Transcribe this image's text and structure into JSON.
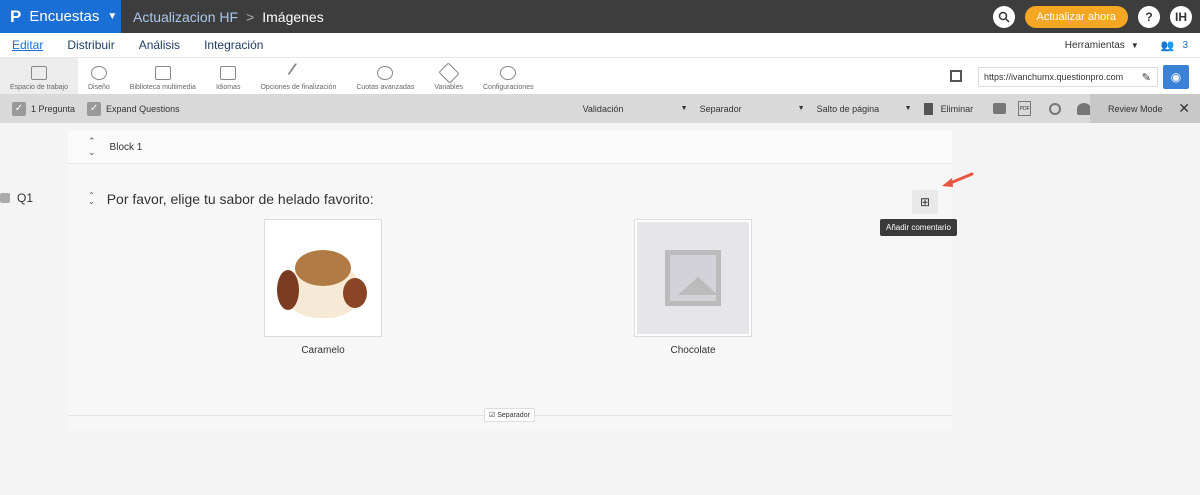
{
  "header": {
    "brand_logo": "P",
    "brand_name": "Encuestas",
    "crumb_survey": "Actualizacion HF",
    "crumb_separator": ">",
    "crumb_page": "Imágenes",
    "update_label": "Actualizar ahora",
    "help_label": "?",
    "user_initials": "IH"
  },
  "menu": {
    "items": [
      "Editar",
      "Distribuir",
      "Análisis",
      "Integración"
    ],
    "tools_label": "Herramientas",
    "collaborators_count": "3"
  },
  "toolbar": {
    "items": [
      "Espacio de trabajo",
      "Diseño",
      "Biblioteca multimedia",
      "Idiomas",
      "Opciones de finalización",
      "Cuotas avanzadas",
      "Variables",
      "Configuraciones"
    ],
    "url": "https://ivanchumx.questionpro.com"
  },
  "graybar": {
    "one_question": "1 Pregunta",
    "expand_questions": "Expand Questions",
    "validation": "Validación",
    "separator": "Separador",
    "page_break": "Salto de página",
    "delete": "Eliminar",
    "review_mode": "Review Mode"
  },
  "block": {
    "title": "Block 1"
  },
  "question": {
    "number": "Q1",
    "text": "Por favor, elige tu sabor de helado favorito:",
    "choices": [
      "Caramelo",
      "Chocolate"
    ],
    "add_comment_tooltip": "Añadir comentario",
    "separator_tag": "Separador"
  },
  "colors": {
    "brand_blue": "#1a6fd6",
    "update_orange": "#f5a623",
    "annotation_arrow": "#e8543f"
  }
}
